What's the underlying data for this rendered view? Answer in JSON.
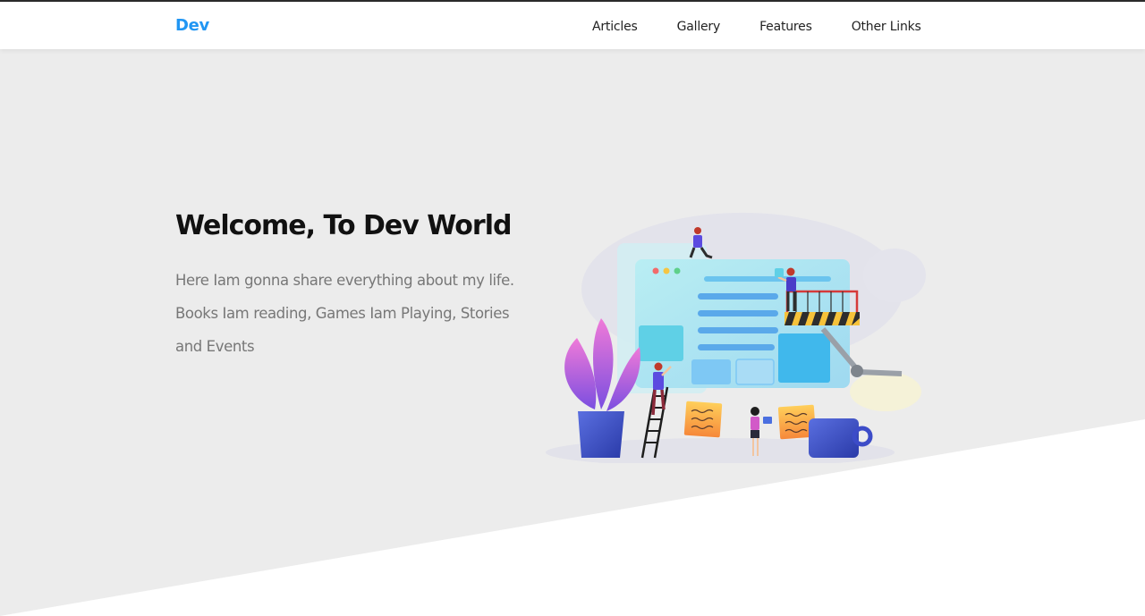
{
  "navbar": {
    "brand": "Dev",
    "links": [
      {
        "label": "Articles"
      },
      {
        "label": "Gallery"
      },
      {
        "label": "Features"
      },
      {
        "label": "Other Links"
      }
    ]
  },
  "hero": {
    "title": "Welcome, To Dev World",
    "text": "Here Iam gonna share everything about my life. Books Iam reading, Games Iam Playing, Stories and Events"
  },
  "colors": {
    "brand": "#2196f3",
    "hero_background": "#ececec",
    "title": "#111111",
    "body_text": "#777777"
  }
}
